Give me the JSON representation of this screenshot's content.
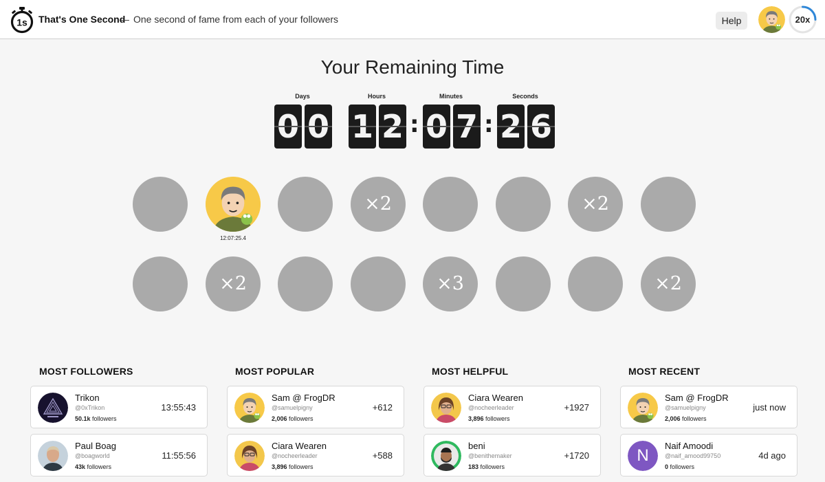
{
  "header": {
    "logo_icon": "stopwatch-1s-icon",
    "app_title": "That's One Second",
    "dash": "—",
    "tagline": "One second of fame from each of your followers",
    "help_label": "Help",
    "multiplier": "20x",
    "multiplier_progress": 0.25,
    "accent_color": "#2f87d8"
  },
  "countdown": {
    "title": "Your Remaining Time",
    "labels": {
      "days": "Days",
      "hours": "Hours",
      "minutes": "Minutes",
      "seconds": "Seconds"
    },
    "digits": {
      "d1": "0",
      "d2": "0",
      "h1": "1",
      "h2": "2",
      "m1": "0",
      "m2": "7",
      "s1": "2",
      "s2": "6"
    },
    "separator": ":"
  },
  "slots": {
    "row1": [
      "",
      "photo",
      "",
      "×2",
      "",
      "",
      "×2",
      ""
    ],
    "row2": [
      "",
      "×2",
      "",
      "",
      "×3",
      "",
      "",
      "×2"
    ],
    "active_time": "12:07:25.4"
  },
  "boards": {
    "most_followers": {
      "title": "MOST FOLLOWERS",
      "items": [
        {
          "name": "Trikon",
          "handle": "@0xTrikon",
          "followers_num": "50.1k",
          "followers_suffix": " followers",
          "value": "13:55:43"
        },
        {
          "name": "Paul Boag",
          "handle": "@boagworld",
          "followers_num": "43k",
          "followers_suffix": " followers",
          "value": "11:55:56"
        }
      ]
    },
    "most_popular": {
      "title": "MOST POPULAR",
      "items": [
        {
          "name": "Sam @ FrogDR",
          "handle": "@samuelpigny",
          "followers_num": "2,006",
          "followers_suffix": " followers",
          "value": "+612"
        },
        {
          "name": "Ciara Wearen",
          "handle": "@nocheerleader",
          "followers_num": "3,896",
          "followers_suffix": " followers",
          "value": "+588"
        }
      ]
    },
    "most_helpful": {
      "title": "MOST HELPFUL",
      "items": [
        {
          "name": "Ciara Wearen",
          "handle": "@nocheerleader",
          "followers_num": "3,896",
          "followers_suffix": " followers",
          "value": "+1927"
        },
        {
          "name": "beni",
          "handle": "@benithemaker",
          "followers_num": "183",
          "followers_suffix": " followers",
          "value": "+1720"
        }
      ]
    },
    "most_recent": {
      "title": "MOST RECENT",
      "items": [
        {
          "name": "Sam @ FrogDR",
          "handle": "@samuelpigny",
          "followers_num": "2,006",
          "followers_suffix": " followers",
          "value": "just now"
        },
        {
          "name": "Naif Amoodi",
          "handle": "@naif_amood99750",
          "followers_num": "0",
          "followers_suffix": " followers",
          "value": "4d ago",
          "initial": "N"
        }
      ]
    }
  }
}
